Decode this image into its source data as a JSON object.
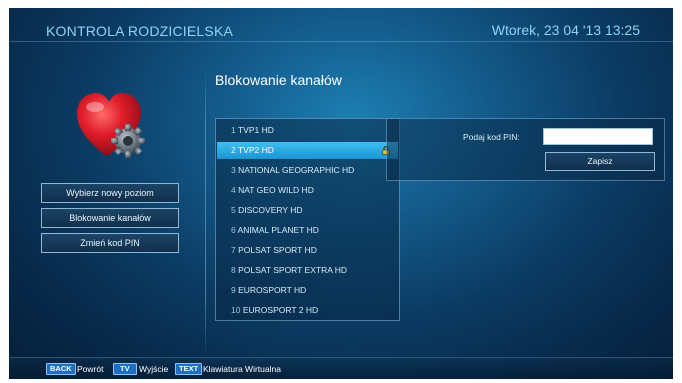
{
  "header": {
    "title": "KONTROLA RODZICIELSKA",
    "datetime": "Wtorek, 23 04 '13 13:25"
  },
  "sidebar": {
    "icon": "heart-gear-icon",
    "buttons": [
      {
        "label": "Wybierz nowy poziom"
      },
      {
        "label": "Blokowanie kanałów"
      },
      {
        "label": "Zmień kod PIN"
      }
    ]
  },
  "main": {
    "heading": "Blokowanie kanałów",
    "channels": [
      {
        "num": "1",
        "name": "TVP1 HD",
        "selected": false,
        "locked": false
      },
      {
        "num": "2",
        "name": "TVP2 HD",
        "selected": true,
        "locked": true
      },
      {
        "num": "3",
        "name": "NATIONAL GEOGRAPHIC HD",
        "selected": false,
        "locked": false
      },
      {
        "num": "4",
        "name": "NAT GEO WILD HD",
        "selected": false,
        "locked": false
      },
      {
        "num": "5",
        "name": "DISCOVERY HD",
        "selected": false,
        "locked": false
      },
      {
        "num": "6",
        "name": "ANIMAL PLANET HD",
        "selected": false,
        "locked": false
      },
      {
        "num": "7",
        "name": "POLSAT SPORT HD",
        "selected": false,
        "locked": false
      },
      {
        "num": "8",
        "name": "POLSAT SPORT EXTRA HD",
        "selected": false,
        "locked": false
      },
      {
        "num": "9",
        "name": "EUROSPORT HD",
        "selected": false,
        "locked": false
      },
      {
        "num": "10",
        "name": "EUROSPORT 2 HD",
        "selected": false,
        "locked": false
      }
    ]
  },
  "pin_panel": {
    "label": "Podaj kod PIN:",
    "value": "",
    "save_label": "Zapisz"
  },
  "footer": {
    "back_key": "BACK",
    "back_label": "Powrót",
    "tv_key": "TV",
    "tv_label": "Wyjście",
    "text_key": "TEXT",
    "text_label": "Klawiatura Wirtualna"
  },
  "colors": {
    "accent_text": "#8fd3f4",
    "selected_row": "#2aaae6",
    "key_badge": "#1e6fc2"
  }
}
